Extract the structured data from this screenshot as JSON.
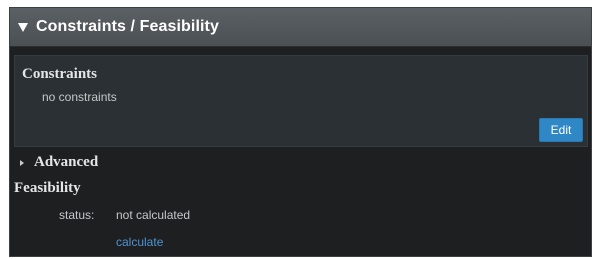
{
  "panel": {
    "title": "Constraints / Feasibility",
    "collapse_icon": "caret-down-icon"
  },
  "constraints": {
    "heading": "Constraints",
    "empty_text": "no constraints",
    "edit_label": "Edit"
  },
  "advanced": {
    "label": "Advanced",
    "expand_icon": "caret-right-icon"
  },
  "feasibility": {
    "heading": "Feasibility",
    "status_label": "status:",
    "status_value": "not calculated",
    "calculate_label": "calculate"
  },
  "colors": {
    "accent": "#2f87c6",
    "link": "#4f93d1",
    "panel_background": "#1d1f21",
    "header_background": "#53585c"
  }
}
